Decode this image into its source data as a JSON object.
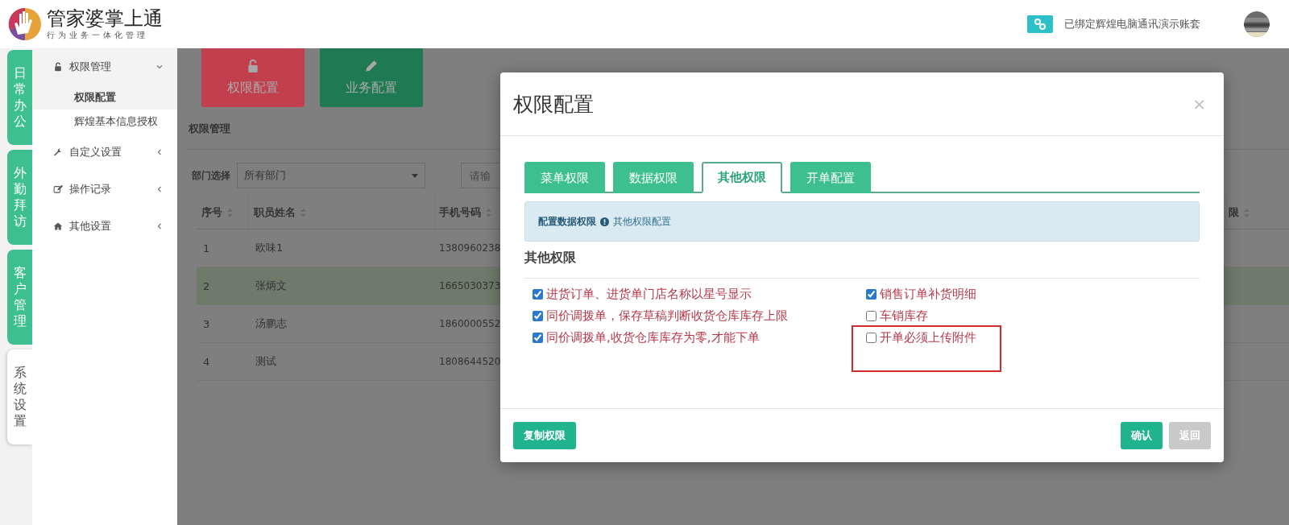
{
  "header": {
    "logo_title": "管家婆掌上通",
    "logo_subtitle": "行为业务一体化管理",
    "account_text": "已绑定辉煌电脑通讯演示账套"
  },
  "rail": [
    {
      "label": "日常办公",
      "selected": false
    },
    {
      "label": "外勤拜访",
      "selected": false
    },
    {
      "label": "客户管理",
      "selected": false
    },
    {
      "label": "系统设置",
      "selected": true
    }
  ],
  "sidebar": {
    "items": [
      {
        "label": "权限管理",
        "expanded": true,
        "children": [
          {
            "label": "权限配置",
            "selected": true
          },
          {
            "label": "辉煌基本信息授权",
            "selected": false
          }
        ]
      },
      {
        "label": "自定义设置",
        "expanded": false
      },
      {
        "label": "操作记录",
        "expanded": false
      },
      {
        "label": "其他设置",
        "expanded": false
      }
    ]
  },
  "tiles": [
    {
      "label": "权限配置",
      "color": "#c2404d"
    },
    {
      "label": "业务配置",
      "color": "#1f7a52"
    }
  ],
  "panel": {
    "title": "权限管理",
    "filter_label": "部门选择",
    "department_select": "所有部门",
    "search_placeholder": "请输",
    "table": {
      "columns": [
        "序号",
        "职员姓名",
        "手机号码",
        "限"
      ],
      "rows": [
        {
          "cells": [
            "1",
            "欧味1",
            "1380960238"
          ],
          "selected": false
        },
        {
          "cells": [
            "2",
            "张炳文",
            "1665030373"
          ],
          "selected": true
        },
        {
          "cells": [
            "3",
            "汤鹏志",
            "1860000552"
          ],
          "selected": false
        },
        {
          "cells": [
            "4",
            "测试",
            "1808644520"
          ],
          "selected": false
        }
      ]
    }
  },
  "dialog": {
    "title": "权限配置",
    "close": "×",
    "tabs": [
      {
        "label": "菜单权限",
        "selected": false
      },
      {
        "label": "数据权限",
        "selected": false
      },
      {
        "label": "其他权限",
        "selected": true
      },
      {
        "label": "开单配置",
        "selected": false
      }
    ],
    "info": {
      "strong": "配置数据权限",
      "text": "其他权限配置"
    },
    "section_title": "其他权限",
    "option_columns": [
      [
        {
          "label": "进货订单、进货单门店名称以星号显示",
          "checked": true
        },
        {
          "label": "同价调拨单，保存草稿判断收货仓库库存上限",
          "checked": true
        },
        {
          "label": "同价调拨单,收货仓库库存为零,才能下单",
          "checked": true
        }
      ],
      [
        {
          "label": "销售订单补货明细",
          "checked": true
        },
        {
          "label": "车销库存",
          "checked": false
        },
        {
          "label": "开单必须上传附件",
          "checked": false,
          "highlighted": true
        }
      ]
    ],
    "copy_button": "复制权限",
    "buttons": [
      {
        "label": "确认",
        "disabled": false
      },
      {
        "label": "返回",
        "disabled": true
      }
    ]
  }
}
